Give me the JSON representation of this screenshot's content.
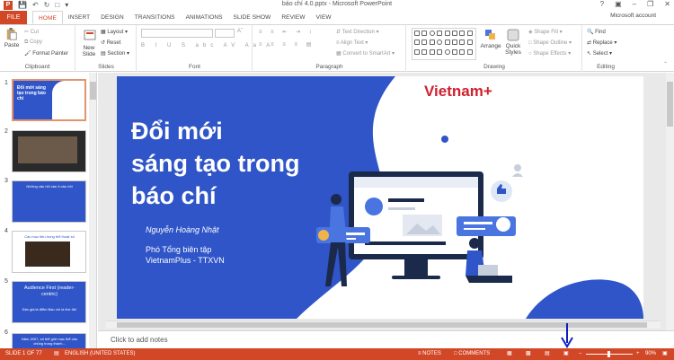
{
  "window": {
    "title": "báo chí 4.0.pptx - Microsoft PowerPoint",
    "account": "Microsoft account"
  },
  "tabs": {
    "file": "FILE",
    "items": [
      "HOME",
      "INSERT",
      "DESIGN",
      "TRANSITIONS",
      "ANIMATIONS",
      "SLIDE SHOW",
      "REVIEW",
      "VIEW"
    ]
  },
  "ribbon": {
    "clipboard": {
      "label": "Clipboard",
      "paste": "Paste",
      "cut": "Cut",
      "copy": "Copy",
      "format_painter": "Format Painter"
    },
    "slides": {
      "label": "Slides",
      "new_slide": "New Slide",
      "layout": "Layout",
      "reset": "Reset",
      "section": "Section"
    },
    "font": {
      "label": "Font"
    },
    "paragraph": {
      "label": "Paragraph",
      "text_direction": "Text Direction",
      "align_text": "Align Text",
      "convert": "Convert to SmartArt"
    },
    "drawing": {
      "label": "Drawing",
      "arrange": "Arrange",
      "quick_styles": "Quick Styles",
      "shape_fill": "Shape Fill",
      "shape_outline": "Shape Outline",
      "shape_effects": "Shape Effects"
    },
    "editing": {
      "label": "Editing",
      "find": "Find",
      "replace": "Replace",
      "select": "Select"
    }
  },
  "thumbnails": [
    {
      "num": "1",
      "title": "Đổi mới sáng tạo trong báo chí"
    },
    {
      "num": "2"
    },
    {
      "num": "3",
      "title": "Những câu hỏi cần ít câu hỏi"
    },
    {
      "num": "4",
      "title": "Các mục tiêu trong thể thuật số"
    },
    {
      "num": "5",
      "title": "Audience First (reader-centric)",
      "sub": "Độc giả là điểm Báo chí là thứ đó!"
    },
    {
      "num": "6",
      "title": "Năm 2007, số thể giới mạc thể câu chủng trung thành..."
    }
  ],
  "slide": {
    "brand": "Vietnam+",
    "title_lines": [
      "Đổi mới",
      "sáng tạo trong",
      "báo chí"
    ],
    "author": "Nguyễn Hoàng Nhật",
    "role_line1": "Phó Tổng biên tập",
    "role_line2": "VietnamPlus - TTXVN",
    "colors": {
      "blue": "#2f55c8",
      "dark_navy": "#1b2a4a",
      "light_blue": "#4a74e0"
    }
  },
  "notes_placeholder": "Click to add notes",
  "status": {
    "slide_count": "SLIDE 1 OF 77",
    "language": "ENGLISH (UNITED STATES)",
    "notes": "NOTES",
    "comments": "COMMENTS",
    "zoom": "90%"
  }
}
